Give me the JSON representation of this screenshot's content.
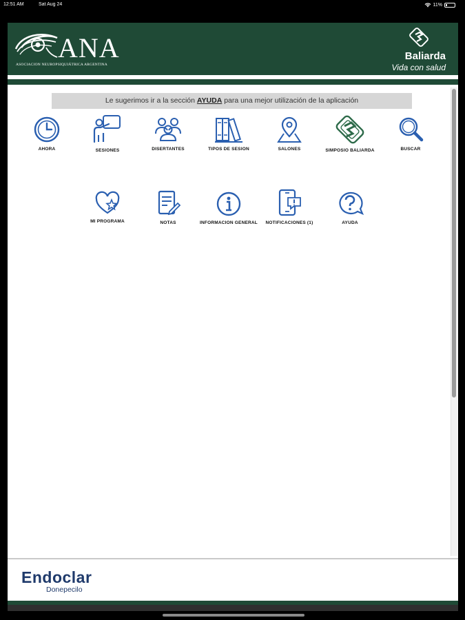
{
  "status": {
    "time": "12:51 AM",
    "date": "Sat Aug 24",
    "battery": "11%"
  },
  "header": {
    "ana_text": "ANA",
    "ana_subtitle": "ASOCIACION NEUROPSIQUIÁTRICA ARGENTINA",
    "baliarda_name": "Baliarda",
    "baliarda_tagline": "Vida con salud",
    "brand_color": "#1f4a36"
  },
  "hint": {
    "before": "Le sugerimos ir a la sección",
    "link": "AYUDA",
    "after": "para una mejor utilización de la aplicación"
  },
  "menu": {
    "row1": [
      {
        "label": "AHORA",
        "icon": "clock-icon"
      },
      {
        "label": "SESIONES",
        "icon": "presenter-icon"
      },
      {
        "label": "DISERTANTES",
        "icon": "people-icon"
      },
      {
        "label": "TIPOS DE SESION",
        "icon": "books-icon"
      },
      {
        "label": "SALONES",
        "icon": "map-pin-icon"
      },
      {
        "label": "SIMPOSIO BALIARDA",
        "icon": "baliarda-logo-icon"
      },
      {
        "label": "BUSCAR",
        "icon": "search-icon"
      }
    ],
    "row2": [
      {
        "label": "MI PROGRAMA",
        "icon": "heart-star-icon"
      },
      {
        "label": "NOTAS",
        "icon": "notes-icon"
      },
      {
        "label": "INFORMACION GENERAL",
        "icon": "info-icon"
      },
      {
        "label": "NOTIFICACIONES (1)",
        "icon": "phone-notification-icon"
      },
      {
        "label": "AYUDA",
        "icon": "help-icon"
      }
    ],
    "icon_color": "#2a5fb0"
  },
  "footer": {
    "product": "Endoclar",
    "product_sub": "Donepecilo",
    "product_color": "#1f3a6b"
  }
}
